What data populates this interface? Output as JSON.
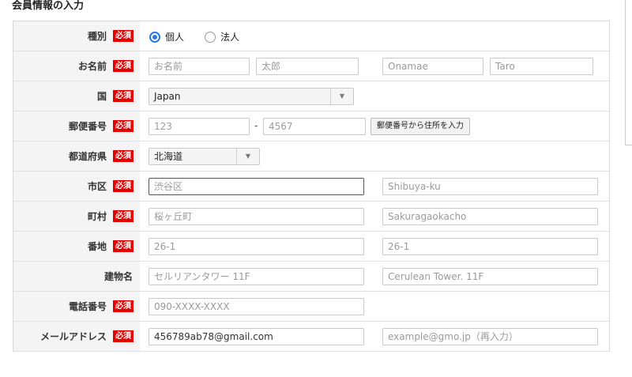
{
  "title": "会員情報の入力",
  "required_badge": "必須",
  "rows": {
    "type": {
      "label": "種別",
      "options": [
        "個人",
        "法人"
      ],
      "selected": "個人"
    },
    "name": {
      "label": "お名前",
      "last_kanji": "お名前",
      "first_kanji": "太郎",
      "last_roman": "Onamae",
      "first_roman": "Taro"
    },
    "country": {
      "label": "国",
      "value": "Japan"
    },
    "postal": {
      "label": "郵便番号",
      "part1": "123",
      "separator": "-",
      "part2": "4567",
      "lookup_button": "郵便番号から住所を入力"
    },
    "prefecture": {
      "label": "都道府県",
      "value": "北海道"
    },
    "city": {
      "label": "市区",
      "jp_placeholder": "渋谷区",
      "en_placeholder": "Shibuya-ku"
    },
    "town": {
      "label": "町村",
      "jp_placeholder": "桜ヶ丘町",
      "en_placeholder": "Sakuragaokacho"
    },
    "block": {
      "label": "番地",
      "jp_placeholder": "26-1",
      "en_placeholder": "26-1"
    },
    "building": {
      "label": "建物名",
      "jp_placeholder": "セルリアンタワー 11F",
      "en_placeholder": "Cerulean Tower. 11F"
    },
    "phone": {
      "label": "電話番号",
      "placeholder": "090-XXXX-XXXX"
    },
    "email": {
      "label": "メールアドレス",
      "value": "456789ab78@gmail.com",
      "confirm_placeholder": "example@gmo.jp（再入力）"
    }
  },
  "colors": {
    "required_badge": "#e30000",
    "radio_selected": "#2a78e6",
    "label_bg": "#f4f4f4"
  }
}
